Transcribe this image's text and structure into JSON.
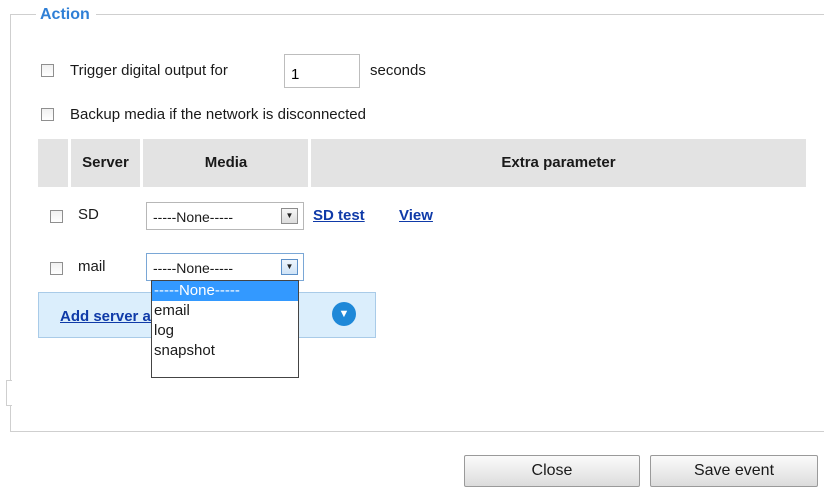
{
  "fieldset": {
    "legend": "Action"
  },
  "trigger": {
    "label_before": "Trigger digital output for",
    "value": "1",
    "label_after": "seconds"
  },
  "backup": {
    "label": "Backup media if the network is disconnected"
  },
  "table": {
    "headers": {
      "server": "Server",
      "media": "Media",
      "extra": "Extra parameter"
    },
    "rows": [
      {
        "server": "SD",
        "media_selected": "-----None-----",
        "links": [
          "SD test",
          "View"
        ]
      },
      {
        "server": "mail",
        "media_selected": "-----None-----"
      }
    ]
  },
  "add_bar": {
    "link_text": "Add server and media"
  },
  "dropdown": {
    "options": [
      "-----None-----",
      "email",
      "log",
      "snapshot"
    ],
    "selected_index": 0
  },
  "buttons": {
    "close": "Close",
    "save": "Save event"
  },
  "icons": {
    "dropdown_arrow": "▼",
    "expand": "chevron-down-circle-icon"
  },
  "colors": {
    "legend": "#2f7fd6",
    "link": "#0f3aa8",
    "highlight": "#3399ff",
    "add_bar": "#dbeefc",
    "expand_icon": "#1e88d8"
  }
}
